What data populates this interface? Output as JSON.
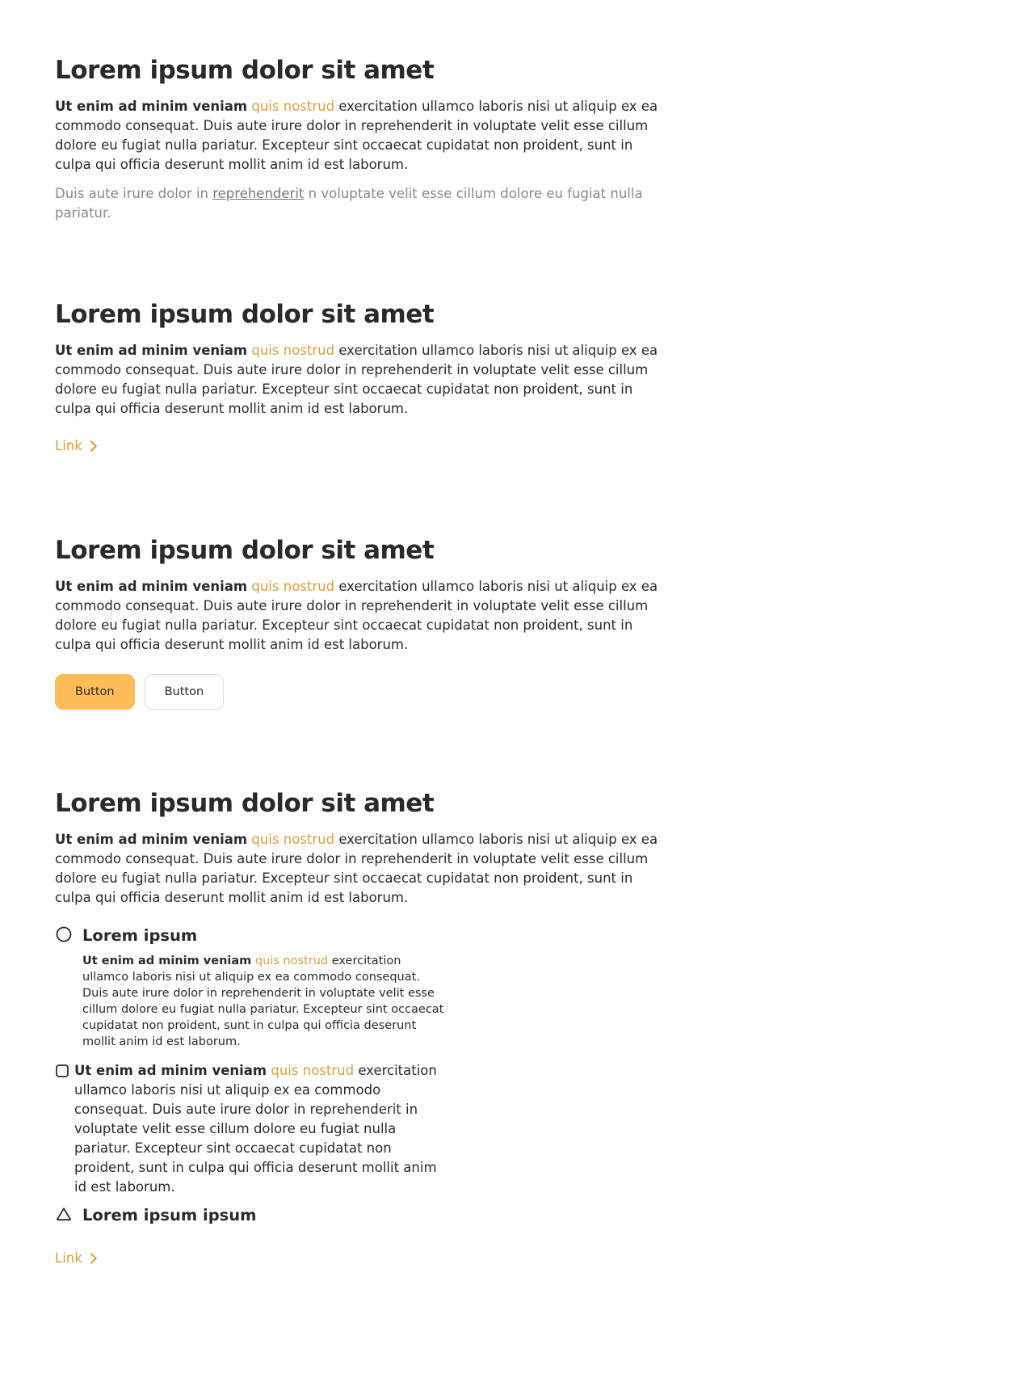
{
  "sections": [
    {
      "title": "Lorem ipsum dolor sit amet",
      "lead_bold": "Ut enim ad minim veniam",
      "lead_accent": "quis nostrud",
      "lead_rest": " exercitation ullamco laboris nisi ut aliquip ex ea commodo consequat. Duis aute irure dolor in reprehenderit in voluptate velit esse cillum dolore eu fugiat nulla pariatur. Excepteur sint occaecat cupidatat non proident, sunt in culpa qui officia deserunt mollit anim id est laborum.",
      "muted_pre": "Duis aute irure dolor in ",
      "muted_link": "reprehenderit",
      "muted_post": " n voluptate velit esse cillum dolore eu fugiat nulla pariatur."
    },
    {
      "title": "Lorem ipsum dolor sit amet",
      "lead_bold": "Ut enim ad minim veniam",
      "lead_accent": "quis nostrud",
      "lead_rest": " exercitation ullamco laboris nisi ut aliquip ex ea commodo consequat. Duis aute irure dolor in reprehenderit in voluptate velit esse cillum dolore eu fugiat nulla pariatur. Excepteur sint occaecat cupidatat non proident, sunt in culpa qui officia deserunt mollit anim id est laborum.",
      "link_label": "Link"
    },
    {
      "title": "Lorem ipsum dolor sit amet",
      "lead_bold": "Ut enim ad minim veniam",
      "lead_accent": "quis nostrud",
      "lead_rest": " exercitation ullamco laboris nisi ut aliquip ex ea commodo consequat. Duis aute irure dolor in reprehenderit in voluptate velit esse cillum dolore eu fugiat nulla pariatur. Excepteur sint occaecat cupidatat non proident, sunt in culpa qui officia deserunt mollit anim id est laborum.",
      "primary_button": "Button",
      "secondary_button": "Button"
    },
    {
      "title": "Lorem ipsum dolor sit amet",
      "lead_bold": "Ut enim ad minim veniam",
      "lead_accent": "quis nostrud",
      "lead_rest": " exercitation ullamco laboris nisi ut aliquip ex ea commodo consequat. Duis aute irure dolor in reprehenderit in voluptate velit esse cillum dolore eu fugiat nulla pariatur. Excepteur sint occaecat cupidatat non proident, sunt in culpa qui officia deserunt mollit anim id est laborum.",
      "items": [
        {
          "icon": "circle-icon",
          "title": "Lorem ipsum",
          "body_bold": "Ut enim ad minim veniam",
          "body_accent": "quis nostrud",
          "body_rest": " exercitation ullamco laboris nisi ut aliquip ex ea commodo consequat. Duis aute irure dolor in reprehenderit in voluptate velit esse cillum dolore eu fugiat nulla pariatur. Excepteur sint occaecat cupidatat non proident, sunt in culpa qui officia deserunt mollit anim id est laborum."
        },
        {
          "icon": "square-icon",
          "body_bold": "Ut enim ad minim veniam",
          "body_accent": "quis nostrud",
          "body_rest": " exercitation ullamco laboris nisi ut aliquip ex ea commodo consequat. Duis aute irure dolor in reprehenderit in voluptate velit esse cillum dolore eu fugiat nulla pariatur. Excepteur sint occaecat cupidatat non proident, sunt in culpa qui officia deserunt mollit anim id est laborum."
        },
        {
          "icon": "triangle-icon",
          "title": "Lorem ipsum ipsum"
        }
      ],
      "link_label": "Link"
    }
  ],
  "colors": {
    "accent": "#d9a143",
    "button_primary": "#ffbd59",
    "text": "#2a2a2a",
    "muted": "#8a8a8a"
  }
}
